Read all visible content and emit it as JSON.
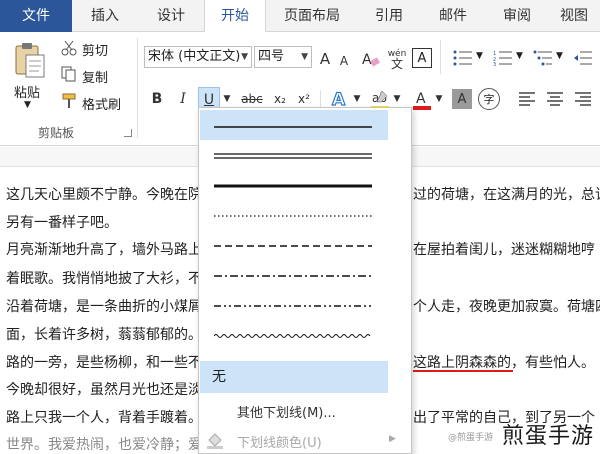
{
  "tabs": [
    "文件",
    "插入",
    "设计",
    "开始",
    "页面布局",
    "引用",
    "邮件",
    "审阅",
    "视图"
  ],
  "clipboard": {
    "paste": "粘贴",
    "cut": "剪切",
    "copy": "复制",
    "format_painter": "格式刷",
    "group": "剪贴板"
  },
  "font": {
    "name": "宋体 (中文正文)",
    "size": "四号",
    "grow": "A",
    "shrink": "A",
    "bold": "B",
    "italic": "I",
    "underline": "U",
    "strike": "abc",
    "sub": "x₂",
    "sup": "x²",
    "pinyin_top": "wén",
    "pinyin_bottom": "文",
    "char_border": "A",
    "circle_char": "字"
  },
  "accent": {
    "brand": "#2b579a",
    "highlight": "#f5e600",
    "font_color": "#e01b1b",
    "selection": "#cde3f7"
  },
  "menu": {
    "none_label": "无",
    "more_underlines": "其他下划线(M)...",
    "underline_color": "下划线颜色(U)"
  },
  "document": {
    "lines": [
      "这几天心里颇不宁静。今晚在院",
      "另有一番样子吧。",
      "月亮渐渐地升高了，墙外马路上",
      "着眠歌。我悄悄地披了大衫，不",
      "沿着荷塘，是一条曲折的小煤屑",
      "面，长着许多树，蓊蓊郁郁的。",
      "路的一旁，是些杨柳，和一些不",
      "今晚却很好，虽然月光也还是淡",
      "路上只我一个人，背着手踱着。",
      "世界。我爱热闹，也爱冷静；爱"
    ],
    "right_lines": [
      "过的荷塘，在这满月的光，总该",
      "",
      "在屋拍着闺儿，迷迷糊糊地哼",
      "",
      "个人走，夜晚更加寂寞。荷塘四",
      "",
      "这路上阴森森的，有些怕人。",
      "",
      "出了平常的自己，到了另一个",
      ""
    ]
  },
  "watermark": "煎蛋手游",
  "watermark_sub": "@煎蛋手游"
}
